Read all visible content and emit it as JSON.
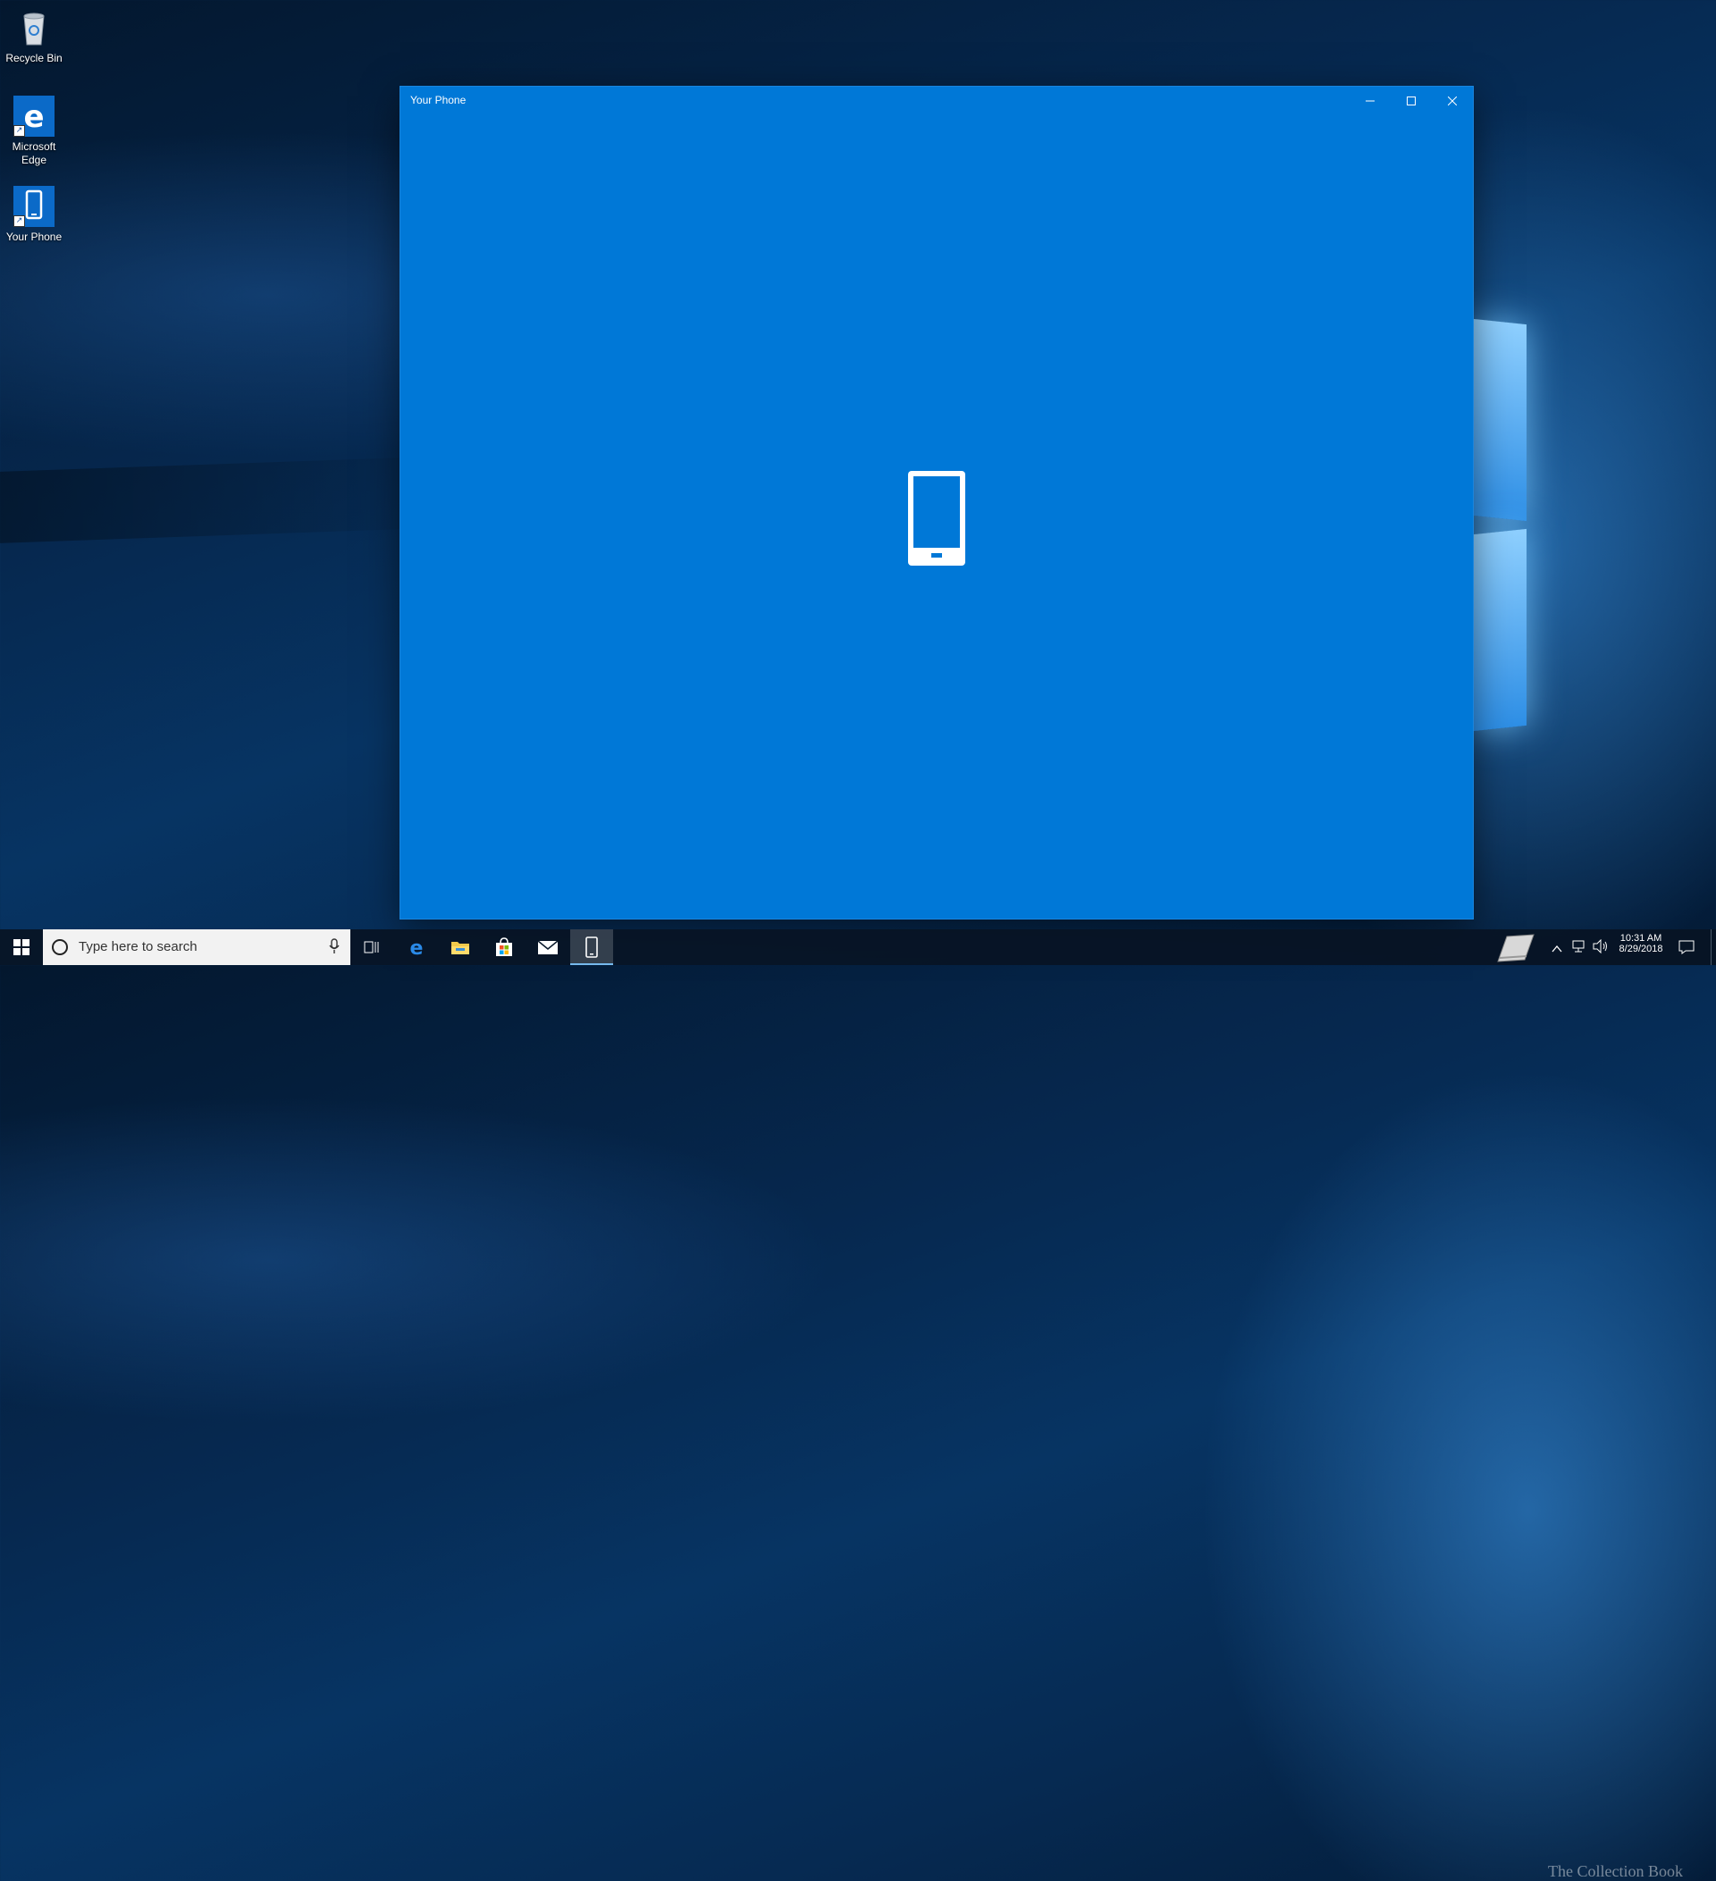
{
  "desktop": {
    "icons": [
      {
        "label": "Recycle Bin"
      },
      {
        "label": "Microsoft Edge"
      },
      {
        "label": "Your Phone"
      }
    ]
  },
  "window": {
    "title": "Your Phone",
    "accent": "#0078d7"
  },
  "taskbar": {
    "search_placeholder": "Type here to search",
    "clock_time": "10:31 AM",
    "clock_date": "8/29/2018",
    "watermark": "The Collection Book",
    "pinned": [
      "start-icon",
      "task-view-icon",
      "edge-icon",
      "file-explorer-icon",
      "store-icon",
      "mail-icon",
      "your-phone-icon"
    ]
  }
}
